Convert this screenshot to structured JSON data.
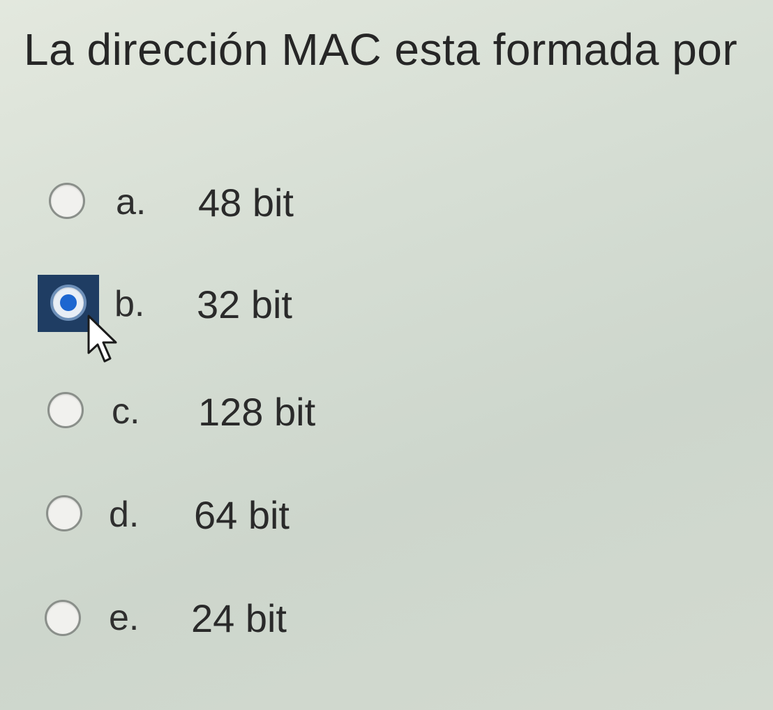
{
  "question": {
    "text": "La dirección MAC esta formada por"
  },
  "options": [
    {
      "letter": "a.",
      "value": "48 bit",
      "selected": false
    },
    {
      "letter": "b.",
      "value": "32 bit",
      "selected": true
    },
    {
      "letter": "c.",
      "value": "128 bit",
      "selected": false
    },
    {
      "letter": "d.",
      "value": "64 bit",
      "selected": false
    },
    {
      "letter": "e.",
      "value": "24 bit",
      "selected": false
    }
  ],
  "colors": {
    "background": "#d6ded4",
    "focus": "#1f3d63",
    "radio_fill_selected": "#1d66d0"
  },
  "icons": {
    "cursor": "mouse-pointer-icon"
  }
}
